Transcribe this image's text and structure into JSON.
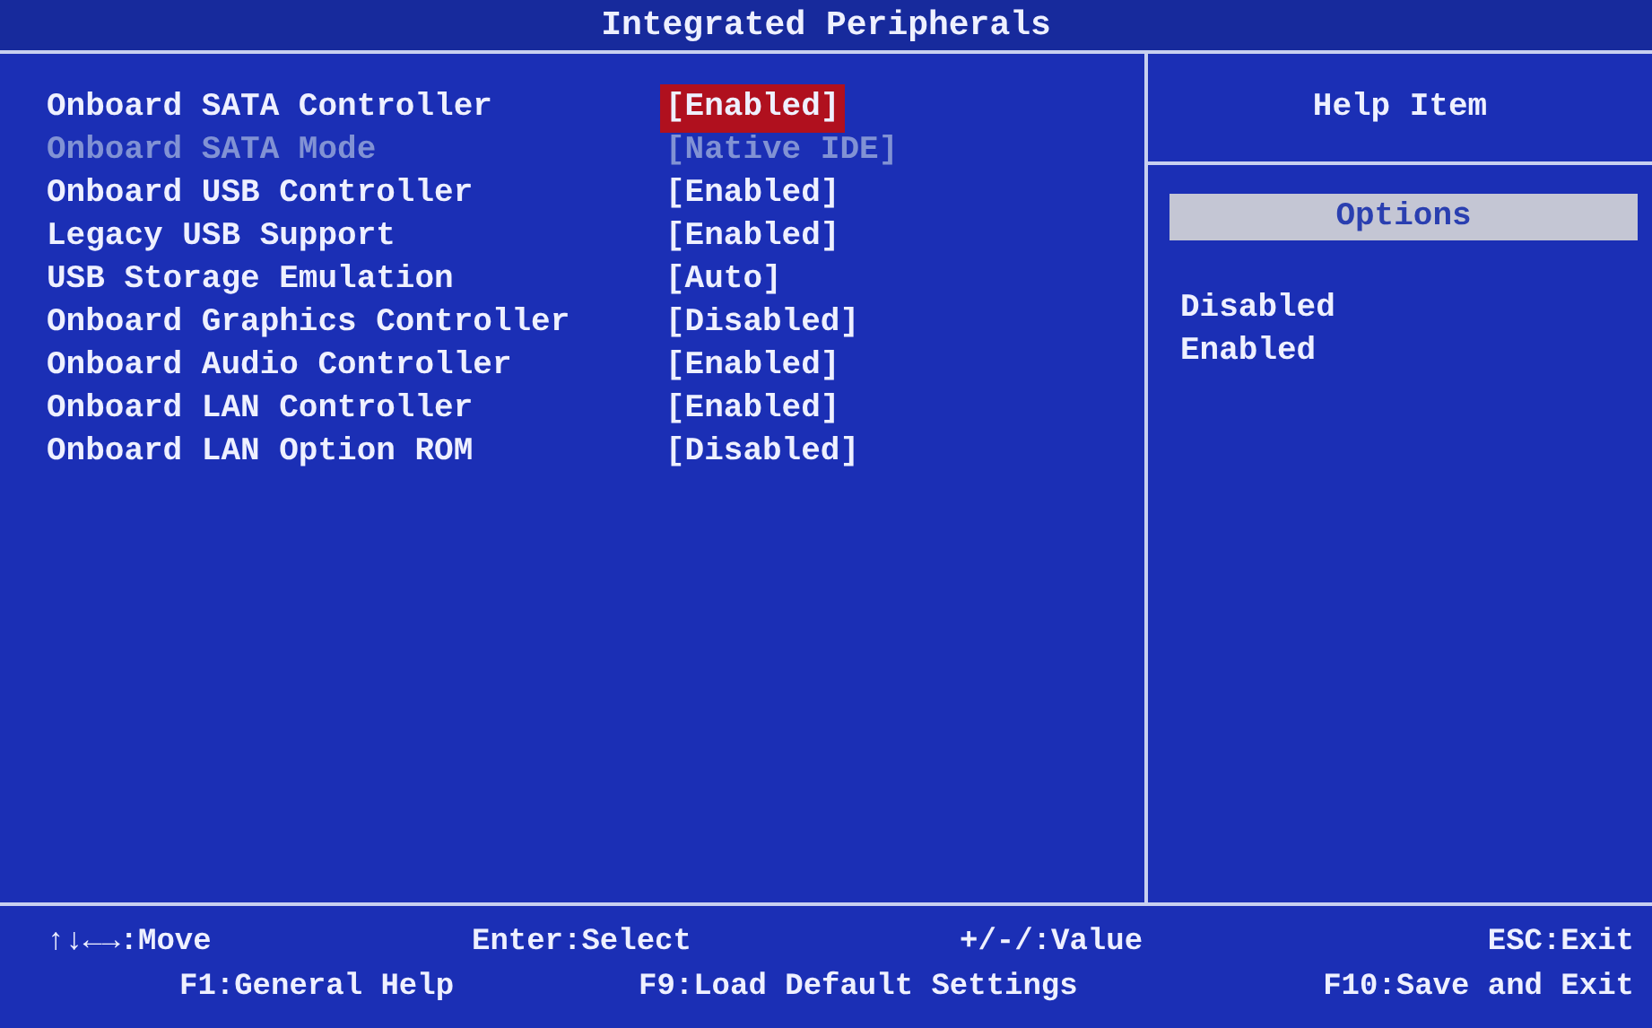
{
  "window": {
    "title": "Integrated Peripherals"
  },
  "settings": [
    {
      "name": "Onboard SATA Controller",
      "value": "[Enabled]",
      "selected": true,
      "disabled": false
    },
    {
      "name": "Onboard SATA Mode",
      "value": "[Native IDE]",
      "selected": false,
      "disabled": true
    },
    {
      "name": "Onboard USB Controller",
      "value": "[Enabled]",
      "selected": false,
      "disabled": false
    },
    {
      "name": "Legacy USB Support",
      "value": "[Enabled]",
      "selected": false,
      "disabled": false
    },
    {
      "name": "USB Storage Emulation",
      "value": "[Auto]",
      "selected": false,
      "disabled": false
    },
    {
      "name": "Onboard Graphics Controller",
      "value": "[Disabled]",
      "selected": false,
      "disabled": false
    },
    {
      "name": "Onboard Audio Controller",
      "value": "[Enabled]",
      "selected": false,
      "disabled": false
    },
    {
      "name": "Onboard LAN Controller",
      "value": "[Enabled]",
      "selected": false,
      "disabled": false
    },
    {
      "name": "Onboard LAN Option ROM",
      "value": "[Disabled]",
      "selected": false,
      "disabled": false
    }
  ],
  "help": {
    "title": "Help Item",
    "options_header": "Options",
    "options": [
      "Disabled",
      "Enabled"
    ]
  },
  "footer": [
    [
      "↑↓←→:Move",
      "Enter:Select",
      "+/-/:Value",
      "ESC:Exit"
    ],
    [
      "F1:General Help",
      "F9:Load Default Settings",
      "F10:Save and Exit"
    ]
  ]
}
